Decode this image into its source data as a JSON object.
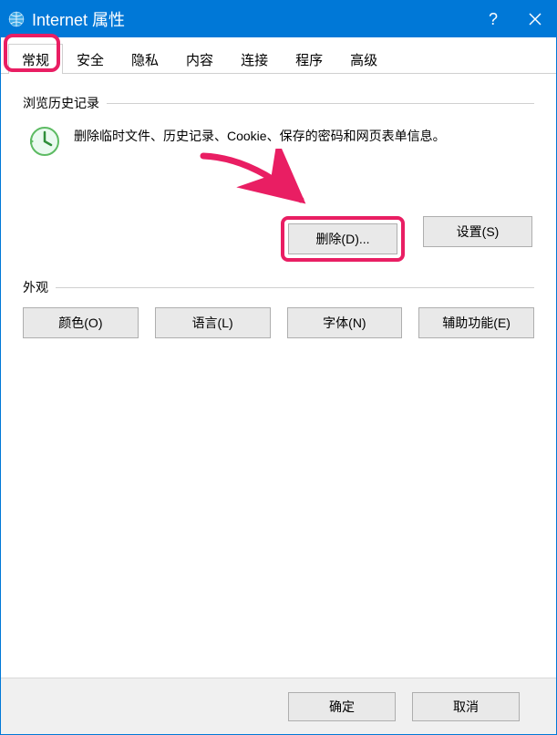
{
  "titlebar": {
    "title": "Internet 属性",
    "help_symbol": "?",
    "close_label": "Close"
  },
  "tabs": {
    "general": "常规",
    "security": "安全",
    "privacy": "隐私",
    "content": "内容",
    "connections": "连接",
    "programs": "程序",
    "advanced": "高级"
  },
  "section_history": {
    "label": "浏览历史记录",
    "description": "删除临时文件、历史记录、Cookie、保存的密码和网页表单信息。",
    "delete_button": "删除(D)...",
    "settings_button": "设置(S)"
  },
  "section_appearance": {
    "label": "外观",
    "colors_button": "颜色(O)",
    "languages_button": "语言(L)",
    "fonts_button": "字体(N)",
    "accessibility_button": "辅助功能(E)"
  },
  "footer": {
    "ok": "确定",
    "cancel": "取消"
  },
  "annotations": {
    "highlight_tab": "general",
    "highlight_button": "delete",
    "arrow_color": "#e91e63"
  }
}
